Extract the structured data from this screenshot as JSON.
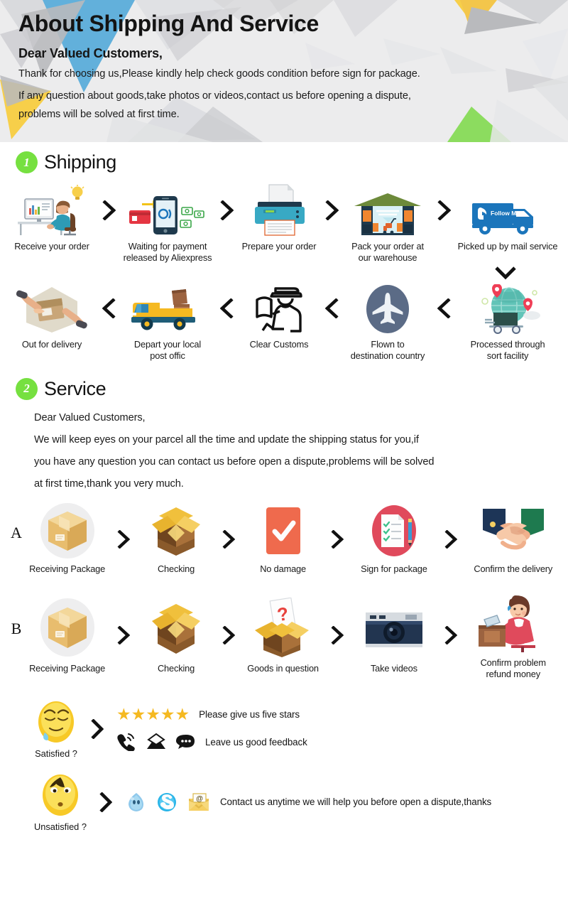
{
  "header": {
    "title": "About Shipping And Service",
    "salutation": "Dear Valued Customers,",
    "line1": "Thank for choosing us,Please kindly help check goods condition before sign for package.",
    "line2": "If any question about goods,take photos or videos,contact us before opening a dispute,",
    "line3": "problems will be solved at first time.",
    "bg_color": "#ececed",
    "accent_blue": "#62b0db",
    "accent_yellow": "#f7cf4a",
    "accent_green": "#8cdc5f",
    "accent_gray": "#bcbcbe"
  },
  "sections": [
    {
      "number": "1",
      "title": "Shipping",
      "badge_color": "#76e040"
    },
    {
      "number": "2",
      "title": "Service",
      "badge_color": "#76e040"
    }
  ],
  "shipping": {
    "row1": [
      {
        "label": "Receive your order",
        "icon": "person-at-desk-icon"
      },
      {
        "label": "Waiting for payment\nreleased by Aliexpress",
        "icon": "mobile-payment-icon"
      },
      {
        "label": "Prepare your order",
        "icon": "printer-icon"
      },
      {
        "label": "Pack your order at\nour warehouse",
        "icon": "warehouse-icon"
      },
      {
        "label": "Picked up by mail service",
        "icon": "delivery-truck-follow-me-icon"
      }
    ],
    "row1_labels": [
      "Receive your order",
      "Waiting for payment",
      "released by Aliexpress",
      "Prepare your order",
      "Pack your order at",
      "our warehouse",
      "Picked up by mail service"
    ],
    "row2": [
      {
        "label": "Out for delivery",
        "icon": "package-handover-icon"
      },
      {
        "label": "Depart your local\npost offic",
        "icon": "yellow-delivery-van-icon"
      },
      {
        "label": "Clear Customs",
        "icon": "customs-officer-icon"
      },
      {
        "label": "Flown to\ndestination country",
        "icon": "airplane-icon"
      },
      {
        "label": "Processed through\nsort facility",
        "icon": "global-sort-facility-icon"
      }
    ],
    "row2_labels": [
      "Out for delivery",
      "Depart your local",
      "post offic",
      "Clear Customs",
      "Flown to",
      "destination country",
      "Processed through",
      "sort facility"
    ],
    "chevron_forward": "chevron-right-icon",
    "chevron_back": "chevron-left-icon",
    "chevron_down": "chevron-down-icon"
  },
  "service": {
    "salutation": "Dear Valued Customers,",
    "line1": "We will keep eyes on your parcel all the time and update the shipping status for you,if",
    "line2": "you have any question you can contact us before open a dispute,problems will be solved",
    "line3": "at first time,thank you very much.",
    "rowA": {
      "letter": "A",
      "steps": [
        {
          "label": "Receiving Package",
          "icon": "cardboard-box-icon"
        },
        {
          "label": "Checking",
          "icon": "open-box-icon"
        },
        {
          "label": "No damage",
          "icon": "checkmark-card-icon"
        },
        {
          "label": "Sign for package",
          "icon": "checklist-pencil-icon"
        },
        {
          "label": "Confirm the delivery",
          "icon": "handshake-icon"
        }
      ]
    },
    "rowB": {
      "letter": "B",
      "steps": [
        {
          "label": "Receiving Package",
          "icon": "cardboard-box-icon"
        },
        {
          "label": "Checking",
          "icon": "open-box-icon"
        },
        {
          "label": "Goods in question",
          "icon": "question-box-icon"
        },
        {
          "label": "Take videos",
          "icon": "camera-icon"
        },
        {
          "label": "Confirm problem\nrefund money",
          "icon": "customer-service-agent-icon"
        }
      ]
    },
    "rowB_label_last_1": "Confirm problem",
    "rowB_label_last_2": "refund money"
  },
  "feedback": {
    "satisfied": {
      "emoji_label": "Satisfied ?",
      "emoji": "relieved-face-icon",
      "stars": "★★★★★",
      "star_count": 5,
      "star_color": "#f5b921",
      "star_text": "Please give us five stars",
      "contact_text": "Leave us good feedback",
      "contact_icons": [
        "phone-ringing-icon",
        "envelope-icon",
        "chat-bubble-icon"
      ]
    },
    "unsatisfied": {
      "emoji_label": "Unsatisfied ?",
      "emoji": "worried-face-icon",
      "text": "Contact us anytime we will help you before open a dispute,thanks",
      "contact_icons": [
        "trademanager-icon",
        "skype-icon",
        "email-at-icon"
      ]
    }
  }
}
